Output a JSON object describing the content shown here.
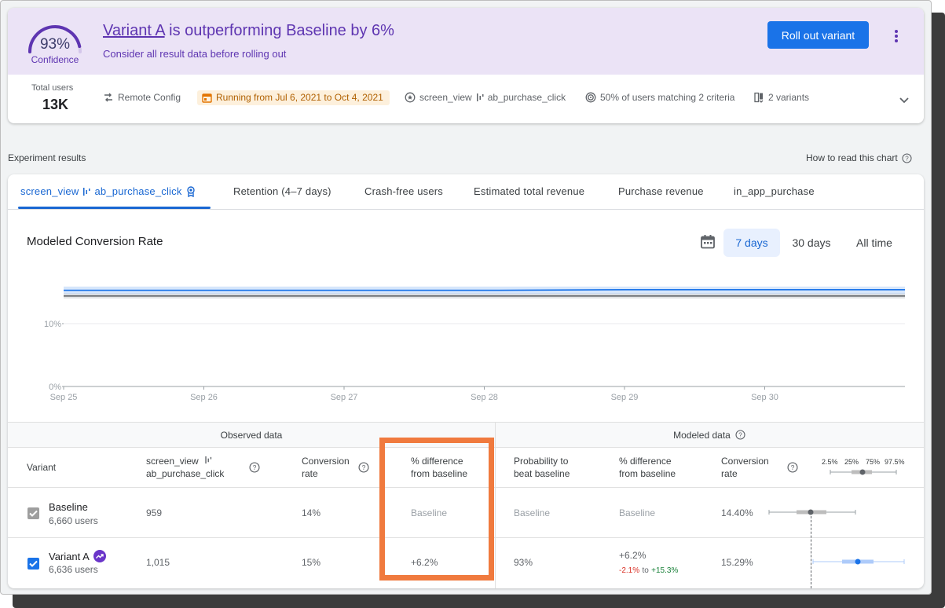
{
  "header": {
    "confidence_value": "93%",
    "confidence_label": "Confidence",
    "headline_link": "Variant A",
    "headline_rest": " is outperforming Baseline by 6%",
    "subline": "Consider all result data before rolling out",
    "rollout_button": "Roll out variant",
    "confidence_fraction": 0.93
  },
  "info": {
    "total_users_label": "Total users",
    "total_users_value": "13K",
    "remote_config": "Remote Config",
    "running": "Running from Jul 6, 2021 to Oct 4, 2021",
    "event_a": "screen_view",
    "event_b": "ab_purchase_click",
    "targeting": "50% of users matching 2 criteria",
    "variants": "2 variants"
  },
  "section": {
    "title": "Experiment results",
    "how_to": "How to read this chart"
  },
  "tabs": {
    "t0a": "screen_view",
    "t0b": "ab_purchase_click",
    "t1": "Retention (4–7 days)",
    "t2": "Crash-free users",
    "t3": "Estimated total revenue",
    "t4": "Purchase revenue",
    "t5": "in_app_purchase"
  },
  "chart_panel": {
    "title": "Modeled Conversion Rate",
    "range_7": "7 days",
    "range_30": "30 days",
    "range_all": "All time"
  },
  "chart_data": {
    "type": "line",
    "title": "Modeled Conversion Rate",
    "x": [
      "Sep 25",
      "Sep 26",
      "Sep 27",
      "Sep 28",
      "Sep 29",
      "Sep 30"
    ],
    "y_ticks": [
      "0%",
      "10%"
    ],
    "ylim": [
      0,
      20
    ],
    "grid": true,
    "series": [
      {
        "color": "#1a73e8",
        "values": [
          15.3,
          15.3,
          15.3,
          15.3,
          15.4,
          15.4,
          15.4
        ],
        "band": [
          14.7,
          15.9
        ]
      },
      {
        "color": "#5f6368",
        "values": [
          14.4,
          14.4,
          14.4,
          14.4,
          14.4,
          14.4,
          14.4
        ],
        "band": [
          14.0,
          14.8
        ]
      }
    ]
  },
  "table": {
    "group_observed": "Observed data",
    "group_modeled": "Modeled data",
    "h_variant": "Variant",
    "h_event_a": "screen_view",
    "h_event_b": "ab_purchase_click",
    "h_conv_1": "Conversion",
    "h_conv_2": "rate",
    "h_diff_1": "% difference",
    "h_diff_2": "from baseline",
    "h_prob_1": "Probability to",
    "h_prob_2": "beat baseline",
    "h_mdiff_1": "% difference",
    "h_mdiff_2": "from baseline",
    "h_mconv_1": "Conversion",
    "h_mconv_2": "rate",
    "q_25": "2.5%",
    "q_250": "25%",
    "q_75": "75%",
    "q_975": "97.5%",
    "rows": [
      {
        "name": "Baseline",
        "users": "6,660 users",
        "events": "959",
        "conv": "14%",
        "diff": "Baseline",
        "prob": "Baseline",
        "mdiff": "Baseline",
        "mconv": "14.40%"
      },
      {
        "name": "Variant A",
        "users": "6,636 users",
        "events": "1,015",
        "conv": "15%",
        "diff": "+6.2%",
        "prob": "93%",
        "mdiff": "+6.2%",
        "ci_lo": "-2.1%",
        "ci_to": "to",
        "ci_hi": "+15.3%",
        "mconv": "15.29%"
      }
    ]
  },
  "colors": {
    "accent_purple": "#5e35b1",
    "primary_blue": "#1a73e8",
    "highlight_orange": "#f07a3e"
  }
}
